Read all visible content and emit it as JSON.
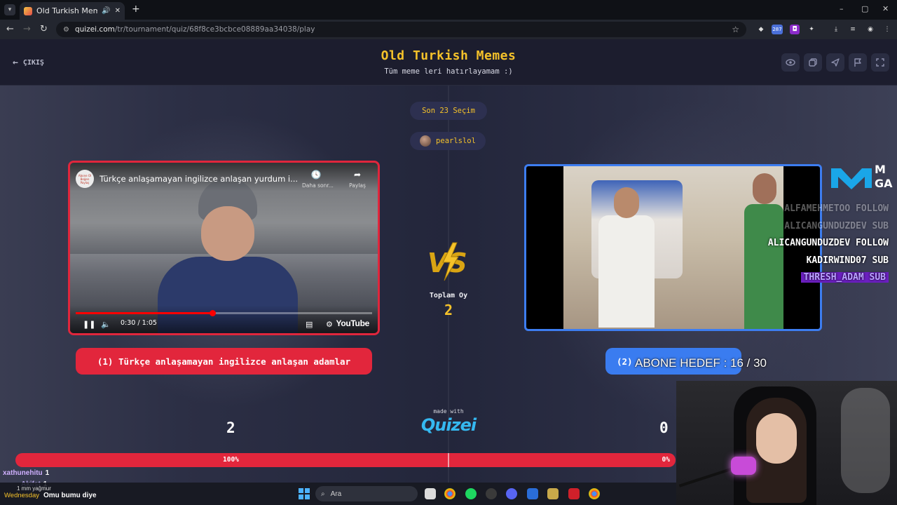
{
  "browser": {
    "tab_title": "Old Turkish Memes - Tier L",
    "new_tab": "+",
    "url_host": "quizei.com",
    "url_path": "/tr/tournament/quiz/68f8ce3bcbce08889aa34038/play",
    "ext_badge": "287",
    "window_controls": [
      "–",
      "▢",
      "✕"
    ]
  },
  "header": {
    "back_label": "ÇIKIŞ",
    "title": "Old Turkish Memes",
    "subtitle": "Tüm meme leri hatırlayamam :)",
    "icons": [
      "eye-icon",
      "copy-icon",
      "send-icon",
      "flag-icon",
      "fullscreen-icon"
    ]
  },
  "round": {
    "label": "Son 23 Seçim",
    "user": "pearlslol"
  },
  "left_video": {
    "channel_badge": "Abone Ol Beğen Paylaş",
    "title": "Türkçe anlaşamayan ingilizce anlaşan yurdum i...",
    "watch_later": "Daha sonr...",
    "share": "Paylaş",
    "time": "0:30 / 1:05",
    "progress": 0.46,
    "logo": "YouTube"
  },
  "center": {
    "total_label": "Toplam Oy",
    "total_value": "2",
    "made_with": "made with",
    "logo": "Quizei"
  },
  "choices": {
    "left_label": "(1) Türkçe anlaşamayan ingilizce anlaşan adamlar",
    "right_label": "(2)"
  },
  "scores": {
    "left": "2",
    "right": "0",
    "left_pct": "100%",
    "right_pct": "0%",
    "left_share": 1.0
  },
  "overlay": {
    "brand_text": [
      "M",
      "GA"
    ],
    "events": [
      {
        "text": "ALFAMEHMETOO FOLLOW",
        "style": "faded"
      },
      {
        "text": "ALICANGUNDUZDEV SUB",
        "style": "faded"
      },
      {
        "text": "ALICANGUNDUZDEV FOLLOW",
        "style": "normal"
      },
      {
        "text": "KADIRWIND07 SUB",
        "style": "normal"
      },
      {
        "text": "THRESH_ADAM SUB",
        "style": "highlight"
      }
    ],
    "abone_hedef": "ABONE HEDEF : 16 / 30"
  },
  "chat": [
    {
      "user": "xathunehitu",
      "text": "1"
    },
    {
      "user": "Akifst",
      "text": "1"
    },
    {
      "user": "Wednesday",
      "text": "Omu bumu diye"
    }
  ],
  "taskbar": {
    "weather_day": "Wednesday",
    "weather_text": "1 mm yağmur",
    "search_placeholder": "Ara"
  },
  "colors": {
    "accent_yellow": "#f5c22a",
    "left_red": "#e2263c",
    "right_blue": "#3a7cf0"
  }
}
